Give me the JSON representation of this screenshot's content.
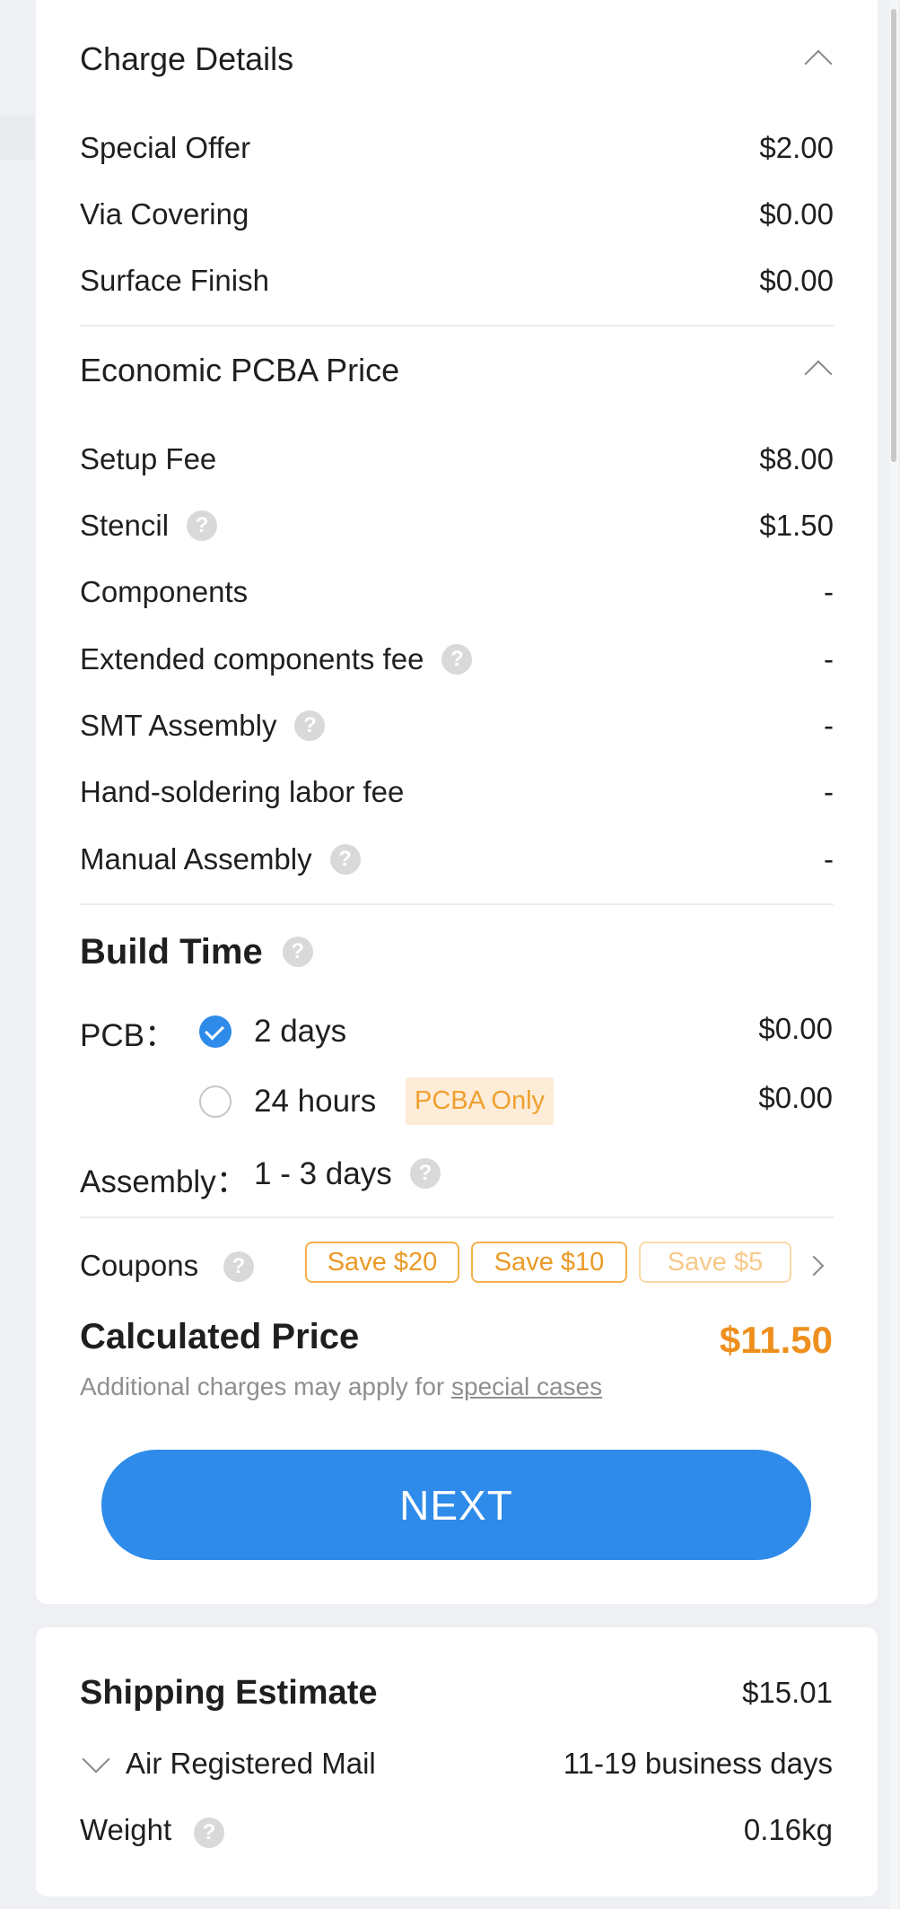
{
  "charge_details": {
    "title": "Charge Details",
    "items": [
      {
        "label": "Special Offer",
        "value": "$2.00"
      },
      {
        "label": "Via Covering",
        "value": "$0.00"
      },
      {
        "label": "Surface Finish",
        "value": "$0.00"
      }
    ]
  },
  "pcba": {
    "title": "Economic PCBA Price",
    "items": [
      {
        "label": "Setup Fee",
        "value": "$8.00"
      },
      {
        "label": "Stencil",
        "value": "$1.50"
      },
      {
        "label": "Components",
        "value": "-"
      },
      {
        "label": "Extended components fee",
        "value": "-"
      },
      {
        "label": "SMT Assembly",
        "value": "-"
      },
      {
        "label": "Hand-soldering labor fee",
        "value": "-"
      },
      {
        "label": "Manual Assembly",
        "value": "-"
      }
    ]
  },
  "build_time": {
    "title": "Build Time",
    "pcb_label": "PCB：",
    "options": [
      {
        "label": "2 days",
        "value": "$0.00",
        "selected": true
      },
      {
        "label": "24 hours",
        "badge": "PCBA Only",
        "value": "$0.00",
        "selected": false
      }
    ],
    "assembly_label": "Assembly：",
    "assembly_value": "1 - 3 days"
  },
  "coupons": {
    "label": "Coupons",
    "items": [
      "Save $20",
      "Save $10",
      "Save $5"
    ]
  },
  "price": {
    "label": "Calculated Price",
    "value": "$11.50",
    "note_prefix": "Additional charges may apply for ",
    "note_link": "special cases",
    "accent_color": "#ee8f1e"
  },
  "next_button": "NEXT",
  "shipping": {
    "title": "Shipping Estimate",
    "total": "$15.01",
    "method": "Air Registered Mail",
    "duration": "11-19 business days",
    "weight_label": "Weight",
    "weight_value": "0.16kg"
  },
  "colors": {
    "primary": "#2e8bea",
    "accent": "#ee8f1e"
  }
}
